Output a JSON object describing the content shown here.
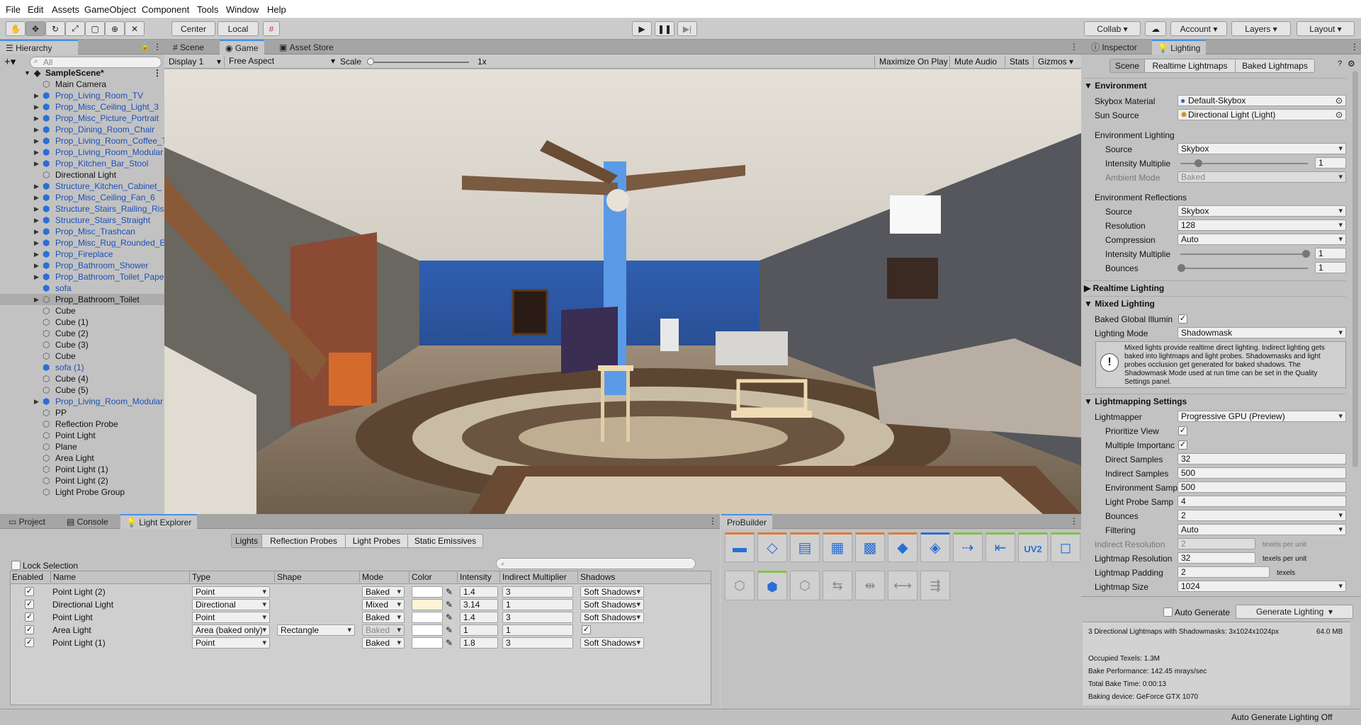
{
  "menu": [
    "File",
    "Edit",
    "Assets",
    "GameObject",
    "Component",
    "Tools",
    "Window",
    "Help"
  ],
  "toolbar": {
    "center": "Center",
    "local": "Local",
    "collab": "Collab",
    "account": "Account",
    "layers": "Layers",
    "layout": "Layout"
  },
  "hierarchy": {
    "title": "Hierarchy",
    "search_placeholder": "All",
    "scene": "SampleScene*",
    "items": [
      {
        "label": "Main Camera",
        "prefab": false,
        "arrow": false
      },
      {
        "label": "Prop_Living_Room_TV",
        "prefab": true,
        "arrow": true
      },
      {
        "label": "Prop_Misc_Ceiling_Light_3",
        "prefab": true,
        "arrow": true
      },
      {
        "label": "Prop_Misc_Picture_Portrait",
        "prefab": true,
        "arrow": true
      },
      {
        "label": "Prop_Dining_Room_Chair",
        "prefab": true,
        "arrow": true
      },
      {
        "label": "Prop_Living_Room_Coffee_T",
        "prefab": true,
        "arrow": true
      },
      {
        "label": "Prop_Living_Room_Modular",
        "prefab": true,
        "arrow": true
      },
      {
        "label": "Prop_Kitchen_Bar_Stool",
        "prefab": true,
        "arrow": true
      },
      {
        "label": "Directional Light",
        "prefab": false,
        "arrow": false
      },
      {
        "label": "Structure_Kitchen_Cabinet_",
        "prefab": true,
        "arrow": true
      },
      {
        "label": "Prop_Misc_Ceiling_Fan_6",
        "prefab": true,
        "arrow": true
      },
      {
        "label": "Structure_Stairs_Railing_Ris",
        "prefab": true,
        "arrow": true
      },
      {
        "label": "Structure_Stairs_Straight",
        "prefab": true,
        "arrow": true
      },
      {
        "label": "Prop_Misc_Trashcan",
        "prefab": true,
        "arrow": true
      },
      {
        "label": "Prop_Misc_Rug_Rounded_E",
        "prefab": true,
        "arrow": true
      },
      {
        "label": "Prop_Fireplace",
        "prefab": true,
        "arrow": true
      },
      {
        "label": "Prop_Bathroom_Shower",
        "prefab": true,
        "arrow": true
      },
      {
        "label": "Prop_Bathroom_Toilet_Pape",
        "prefab": true,
        "arrow": true
      },
      {
        "label": "sofa",
        "prefab": true,
        "arrow": false
      },
      {
        "label": "Prop_Bathroom_Toilet",
        "prefab": false,
        "arrow": true,
        "selected": true
      },
      {
        "label": "Cube",
        "prefab": false,
        "arrow": false
      },
      {
        "label": "Cube (1)",
        "prefab": false,
        "arrow": false
      },
      {
        "label": "Cube (2)",
        "prefab": false,
        "arrow": false
      },
      {
        "label": "Cube (3)",
        "prefab": false,
        "arrow": false
      },
      {
        "label": "Cube",
        "prefab": false,
        "arrow": false
      },
      {
        "label": "sofa (1)",
        "prefab": true,
        "arrow": false
      },
      {
        "label": "Cube (4)",
        "prefab": false,
        "arrow": false
      },
      {
        "label": "Cube (5)",
        "prefab": false,
        "arrow": false
      },
      {
        "label": "Prop_Living_Room_Modular",
        "prefab": true,
        "arrow": true
      },
      {
        "label": "PP",
        "prefab": false,
        "arrow": false
      },
      {
        "label": "Reflection Probe",
        "prefab": false,
        "arrow": false
      },
      {
        "label": "Point Light",
        "prefab": false,
        "arrow": false
      },
      {
        "label": "Plane",
        "prefab": false,
        "arrow": false
      },
      {
        "label": "Area Light",
        "prefab": false,
        "arrow": false
      },
      {
        "label": "Point Light (1)",
        "prefab": false,
        "arrow": false
      },
      {
        "label": "Point Light (2)",
        "prefab": false,
        "arrow": false
      },
      {
        "label": "Light Probe Group",
        "prefab": false,
        "arrow": false
      }
    ]
  },
  "view_tabs": [
    "Scene",
    "Game",
    "Asset Store"
  ],
  "game_bar": {
    "display": "Display 1",
    "aspect": "Free Aspect",
    "scale_label": "Scale",
    "scale_value": "1x",
    "maximize": "Maximize On Play",
    "mute": "Mute Audio",
    "stats": "Stats",
    "gizmos": "Gizmos"
  },
  "inspector": {
    "tabs": [
      "Inspector",
      "Lighting"
    ],
    "subtabs": [
      "Scene",
      "Realtime Lightmaps",
      "Baked Lightmaps"
    ],
    "environment": {
      "title": "Environment",
      "skybox_label": "Skybox Material",
      "skybox_value": "Default-Skybox",
      "sun_label": "Sun Source",
      "sun_value": "Directional Light (Light)",
      "env_lighting": "Environment Lighting",
      "source_label": "Source",
      "source_value": "Skybox",
      "intensity_label": "Intensity Multiplie",
      "intensity_value": "1",
      "ambient_label": "Ambient Mode",
      "ambient_value": "Baked",
      "env_refl": "Environment Reflections",
      "rsource_label": "Source",
      "rsource_value": "Skybox",
      "res_label": "Resolution",
      "res_value": "128",
      "comp_label": "Compression",
      "comp_value": "Auto",
      "rint_label": "Intensity Multiplie",
      "rint_value": "1",
      "bounces_label": "Bounces",
      "bounces_value": "1"
    },
    "realtime": "Realtime Lighting",
    "mixed": {
      "title": "Mixed Lighting",
      "baked_gi_label": "Baked Global Illumin",
      "mode_label": "Lighting Mode",
      "mode_value": "Shadowmask",
      "help": "Mixed lights provide realtime direct lighting. Indirect lighting gets baked into lightmaps and light probes. Shadowmasks and light probes occlusion get generated for baked shadows. The Shadowmask Mode used at run time can be set in the Quality Settings panel."
    },
    "lightmapping": {
      "title": "Lightmapping Settings",
      "lightmapper_label": "Lightmapper",
      "lightmapper_value": "Progressive GPU (Preview)",
      "prioritize_label": "Prioritize View",
      "multiple_label": "Multiple Importanc",
      "direct_label": "Direct Samples",
      "direct_value": "32",
      "indirect_label": "Indirect Samples",
      "indirect_value": "500",
      "env_samp_label": "Environment Samp",
      "env_samp_value": "500",
      "probe_label": "Light Probe Samp",
      "probe_value": "4",
      "bounces_label": "Bounces",
      "bounces_value": "2",
      "filter_label": "Filtering",
      "filter_value": "Auto",
      "ind_res_label": "Indirect Resolution",
      "ind_res_value": "2",
      "texels_unit": "texels per unit",
      "lm_res_label": "Lightmap Resolution",
      "lm_res_value": "32",
      "lm_res_unit": "texels per unit",
      "padding_label": "Lightmap Padding",
      "padding_value": "2",
      "padding_unit": "texels",
      "size_label": "Lightmap Size",
      "size_value": "1024"
    },
    "auto_generate": "Auto Generate",
    "generate_button": "Generate Lighting",
    "stats": {
      "line1": "3 Directional Lightmaps with Shadowmasks: 3x1024x1024px",
      "mem": "64.0 MB",
      "occupied": "Occupied Texels: 1.3M",
      "perf": "Bake Performance: 142.45 mrays/sec",
      "total": "Total Bake Time: 0:00:13",
      "device": "Baking device: GeForce GTX 1070"
    }
  },
  "bottom_tabs": [
    "Project",
    "Console",
    "Light Explorer"
  ],
  "light_explorer": {
    "tabs": [
      "Lights",
      "Reflection Probes",
      "Light Probes",
      "Static Emissives"
    ],
    "lock": "Lock Selection",
    "columns": [
      "Enabled",
      "Name",
      "Type",
      "Shape",
      "Mode",
      "Color",
      "Intensity",
      "Indirect Multiplier",
      "Shadows"
    ],
    "rows": [
      {
        "name": "Point Light (2)",
        "type": "Point",
        "shape": "",
        "mode": "Baked",
        "color": "#ffffff",
        "intensity": "1.4",
        "indirect": "3",
        "shadows": "Soft Shadows"
      },
      {
        "name": "Directional Light",
        "type": "Directional",
        "shape": "",
        "mode": "Mixed",
        "color": "#fff4d8",
        "intensity": "3.14",
        "indirect": "1",
        "shadows": "Soft Shadows"
      },
      {
        "name": "Point Light",
        "type": "Point",
        "shape": "",
        "mode": "Baked",
        "color": "#ffffff",
        "intensity": "1.4",
        "indirect": "3",
        "shadows": "Soft Shadows"
      },
      {
        "name": "Area Light",
        "type": "Area (baked only)",
        "shape": "Rectangle",
        "mode": "Baked",
        "color": "#ffffff",
        "intensity": "1",
        "indirect": "1",
        "shadows": "✓"
      },
      {
        "name": "Point Light (1)",
        "type": "Point",
        "shape": "",
        "mode": "Baked",
        "color": "#ffffff",
        "intensity": "1.8",
        "indirect": "3",
        "shadows": "Soft Shadows"
      }
    ]
  },
  "probuilder": {
    "title": "ProBuilder",
    "uv_label": "UV2"
  },
  "status": "Auto Generate Lighting Off"
}
